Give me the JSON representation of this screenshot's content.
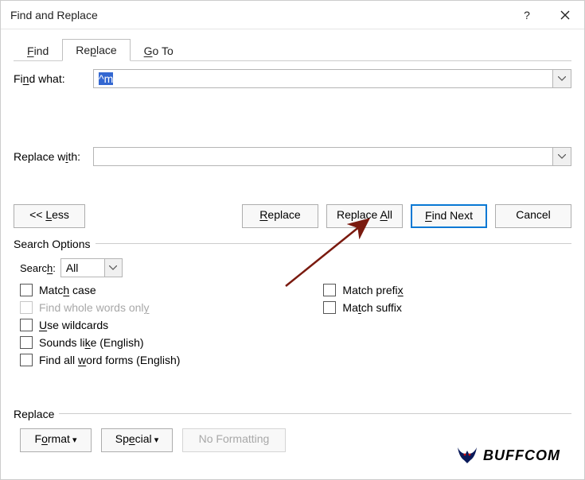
{
  "titlebar": {
    "title": "Find and Replace"
  },
  "tabs": {
    "find": "Find",
    "replace": "Replace",
    "goto": "Go To"
  },
  "find": {
    "label": "Find what:",
    "value": "^m"
  },
  "replace": {
    "label": "Replace with:",
    "value": ""
  },
  "buttons": {
    "less": "<< Less",
    "replace": "Replace",
    "replace_all": "Replace All",
    "find_next": "Find Next",
    "cancel": "Cancel"
  },
  "search_options": {
    "heading": "Search Options",
    "search_label": "Search:",
    "search_value": "All",
    "match_case": "Match case",
    "whole_words": "Find whole words only",
    "use_wildcards": "Use wildcards",
    "sounds_like": "Sounds like (English)",
    "all_word_forms": "Find all word forms (English)",
    "match_prefix": "Match prefix",
    "match_suffix": "Match suffix"
  },
  "replace_section": {
    "heading": "Replace",
    "format": "Format",
    "special": "Special",
    "no_formatting": "No Formatting"
  },
  "logo": {
    "text": "BUFFCOM"
  }
}
